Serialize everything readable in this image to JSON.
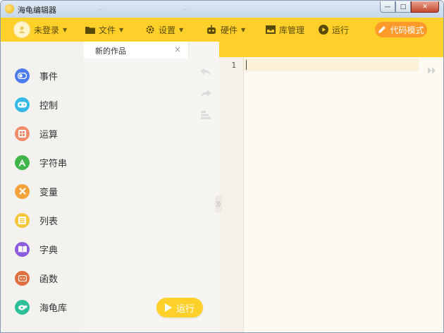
{
  "window": {
    "title": "海龟编辑器",
    "ghost_text_1": "...",
    "ghost_text_2": "...",
    "min_icon": "—",
    "max_icon": "□",
    "close_icon": "✕"
  },
  "toolbar": {
    "login_label": "未登录",
    "file_label": "文件",
    "settings_label": "设置",
    "hardware_label": "硬件",
    "library_label": "库管理",
    "run_label": "运行",
    "code_mode_label": "代码模式",
    "caret": "▼"
  },
  "categories": [
    {
      "label": "事件",
      "color": "#4a7cf0",
      "icon": "toggle-icon"
    },
    {
      "label": "控制",
      "color": "#33b8e8",
      "icon": "gamepad-icon"
    },
    {
      "label": "运算",
      "color": "#f08c6a",
      "icon": "calculator-icon"
    },
    {
      "label": "字符串",
      "color": "#3fb54a",
      "icon": "letter-a-icon"
    },
    {
      "label": "变量",
      "color": "#f4a23a",
      "icon": "x-variable-icon"
    },
    {
      "label": "列表",
      "color": "#f6c63a",
      "icon": "list-icon"
    },
    {
      "label": "字典",
      "color": "#8b5ce0",
      "icon": "book-icon"
    },
    {
      "label": "函数",
      "color": "#e2703e",
      "icon": "function-icon"
    },
    {
      "label": "海龟库",
      "color": "#2dbf9a",
      "icon": "turtle-icon"
    }
  ],
  "workspace": {
    "tab_label": "新的作品",
    "tab_close": "×",
    "run_label": "运行"
  },
  "editor": {
    "line_number": "1"
  },
  "colors": {
    "toolbar": "#ffd02a",
    "code_mode": "#ff9a2a",
    "run_button": "#ffcf2a"
  }
}
